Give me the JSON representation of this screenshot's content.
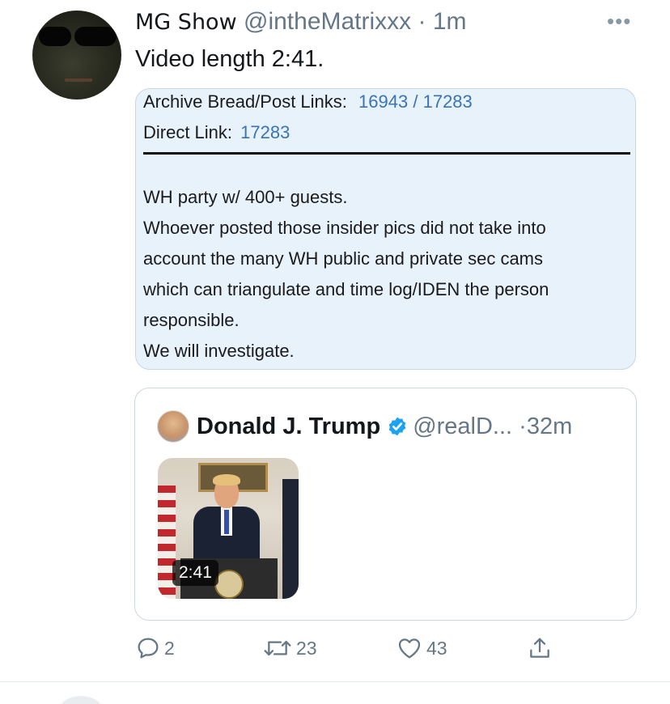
{
  "tweet": {
    "display_name": "MG Show",
    "handle": "@intheMatrixxx",
    "separator": "·",
    "time": "1m",
    "more_label": "•••",
    "text": "Video length 2:41."
  },
  "card": {
    "archive_label": "Archive Bread/Post Links:",
    "archive_link_1": "16943",
    "archive_slash": "/",
    "archive_link_2": "17283",
    "direct_label": "Direct Link:",
    "direct_link": "17283",
    "body_lines": [
      "WH party w/ 400+ guests.",
      "Whoever posted those insider pics did not take into",
      "account the many WH public and private sec cams",
      "which can triangulate and time log/IDEN the person",
      "responsible.",
      "We will investigate."
    ]
  },
  "quoted": {
    "display_name": "Donald J. Trump",
    "handle": "@realD...",
    "separator": "·",
    "time": "32m",
    "video_duration": "2:41"
  },
  "actions": {
    "reply_count": "2",
    "retweet_count": "23",
    "like_count": "43"
  },
  "icons": [
    "reply-icon",
    "retweet-icon",
    "like-icon",
    "share-icon",
    "verified-badge-icon",
    "more-icon"
  ],
  "colors": {
    "link": "#3a73b8",
    "card_background": "#e7f2fb",
    "muted_text": "#657786",
    "verified": "#1da1f2"
  }
}
